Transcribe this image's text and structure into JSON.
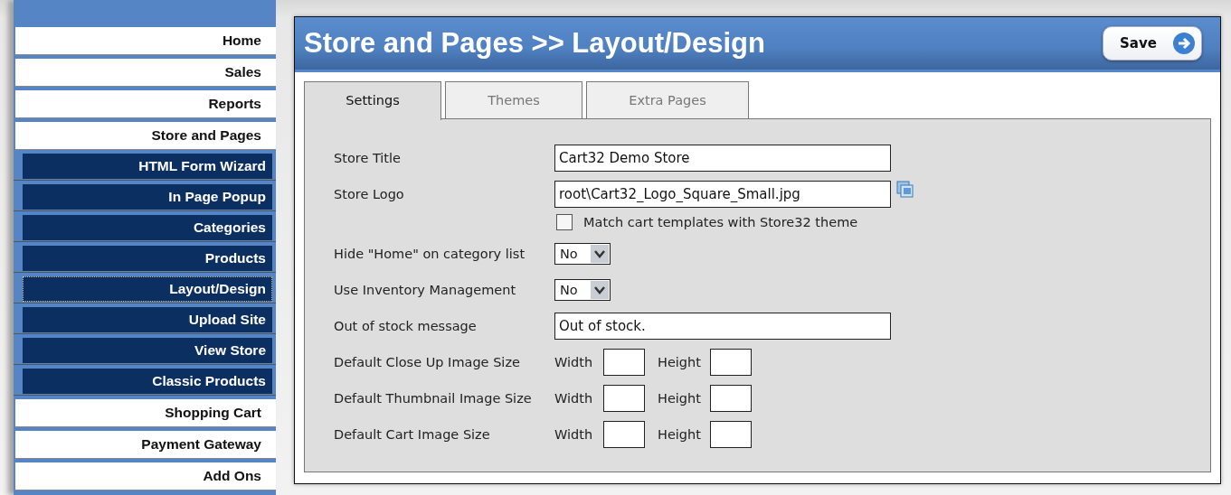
{
  "sidebar": {
    "items": [
      {
        "label": "Home",
        "kind": "main",
        "selected": false
      },
      {
        "label": "Sales",
        "kind": "main",
        "selected": false
      },
      {
        "label": "Reports",
        "kind": "main",
        "selected": false
      },
      {
        "label": "Store and Pages",
        "kind": "main",
        "selected": false
      },
      {
        "label": "HTML Form Wizard",
        "kind": "sub",
        "selected": false
      },
      {
        "label": "In Page Popup",
        "kind": "sub",
        "selected": false
      },
      {
        "label": "Categories",
        "kind": "sub",
        "selected": false
      },
      {
        "label": "Products",
        "kind": "sub",
        "selected": false
      },
      {
        "label": "Layout/Design",
        "kind": "sub",
        "selected": true
      },
      {
        "label": "Upload Site",
        "kind": "sub",
        "selected": false
      },
      {
        "label": "View Store",
        "kind": "sub",
        "selected": false
      },
      {
        "label": "Classic Products",
        "kind": "sub",
        "selected": false
      },
      {
        "label": "Shopping Cart",
        "kind": "main",
        "selected": false
      },
      {
        "label": "Payment Gateway",
        "kind": "main",
        "selected": false
      },
      {
        "label": "Add Ons",
        "kind": "main",
        "selected": false
      }
    ]
  },
  "header": {
    "title": "Store and Pages >> Layout/Design",
    "save_button": "Save"
  },
  "tabs": [
    {
      "label": "Settings",
      "selected": true
    },
    {
      "label": "Themes",
      "selected": false
    },
    {
      "label": "Extra Pages",
      "selected": false
    }
  ],
  "form": [
    {
      "kind": "text",
      "label": "Store Title",
      "value": "Cart32 Demo Store"
    },
    {
      "kind": "file",
      "label": "Store Logo",
      "value": "root\\Cart32_Logo_Square_Small.jpg"
    },
    {
      "kind": "checkbox",
      "label": "Match cart templates with Store32 theme",
      "checked": false
    },
    {
      "kind": "select",
      "label": "Hide \"Home\" on category list",
      "value": "No"
    },
    {
      "kind": "select",
      "label": "Use Inventory Management",
      "value": "No"
    },
    {
      "kind": "text",
      "label": "Out of stock message",
      "value": "Out of stock."
    },
    {
      "kind": "size",
      "label": "Default Close Up Image Size",
      "width_label": "Width",
      "height_label": "Height"
    },
    {
      "kind": "size",
      "label": "Default Thumbnail Image Size",
      "width_label": "Width",
      "height_label": "Height"
    },
    {
      "kind": "size",
      "label": "Default Cart Image Size",
      "width_label": "Width",
      "height_label": "Height"
    }
  ]
}
